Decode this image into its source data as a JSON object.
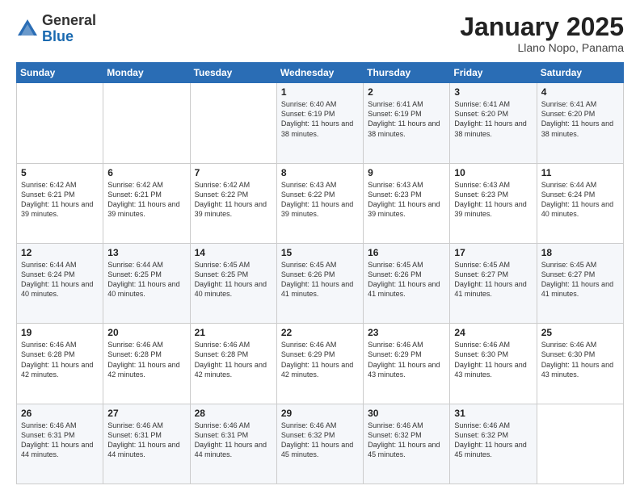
{
  "header": {
    "logo_general": "General",
    "logo_blue": "Blue",
    "month_title": "January 2025",
    "location": "Llano Nopo, Panama"
  },
  "days_of_week": [
    "Sunday",
    "Monday",
    "Tuesday",
    "Wednesday",
    "Thursday",
    "Friday",
    "Saturday"
  ],
  "weeks": [
    [
      {
        "day": "",
        "info": ""
      },
      {
        "day": "",
        "info": ""
      },
      {
        "day": "",
        "info": ""
      },
      {
        "day": "1",
        "info": "Sunrise: 6:40 AM\nSunset: 6:19 PM\nDaylight: 11 hours\nand 38 minutes."
      },
      {
        "day": "2",
        "info": "Sunrise: 6:41 AM\nSunset: 6:19 PM\nDaylight: 11 hours\nand 38 minutes."
      },
      {
        "day": "3",
        "info": "Sunrise: 6:41 AM\nSunset: 6:20 PM\nDaylight: 11 hours\nand 38 minutes."
      },
      {
        "day": "4",
        "info": "Sunrise: 6:41 AM\nSunset: 6:20 PM\nDaylight: 11 hours\nand 38 minutes."
      }
    ],
    [
      {
        "day": "5",
        "info": "Sunrise: 6:42 AM\nSunset: 6:21 PM\nDaylight: 11 hours\nand 39 minutes."
      },
      {
        "day": "6",
        "info": "Sunrise: 6:42 AM\nSunset: 6:21 PM\nDaylight: 11 hours\nand 39 minutes."
      },
      {
        "day": "7",
        "info": "Sunrise: 6:42 AM\nSunset: 6:22 PM\nDaylight: 11 hours\nand 39 minutes."
      },
      {
        "day": "8",
        "info": "Sunrise: 6:43 AM\nSunset: 6:22 PM\nDaylight: 11 hours\nand 39 minutes."
      },
      {
        "day": "9",
        "info": "Sunrise: 6:43 AM\nSunset: 6:23 PM\nDaylight: 11 hours\nand 39 minutes."
      },
      {
        "day": "10",
        "info": "Sunrise: 6:43 AM\nSunset: 6:23 PM\nDaylight: 11 hours\nand 39 minutes."
      },
      {
        "day": "11",
        "info": "Sunrise: 6:44 AM\nSunset: 6:24 PM\nDaylight: 11 hours\nand 40 minutes."
      }
    ],
    [
      {
        "day": "12",
        "info": "Sunrise: 6:44 AM\nSunset: 6:24 PM\nDaylight: 11 hours\nand 40 minutes."
      },
      {
        "day": "13",
        "info": "Sunrise: 6:44 AM\nSunset: 6:25 PM\nDaylight: 11 hours\nand 40 minutes."
      },
      {
        "day": "14",
        "info": "Sunrise: 6:45 AM\nSunset: 6:25 PM\nDaylight: 11 hours\nand 40 minutes."
      },
      {
        "day": "15",
        "info": "Sunrise: 6:45 AM\nSunset: 6:26 PM\nDaylight: 11 hours\nand 41 minutes."
      },
      {
        "day": "16",
        "info": "Sunrise: 6:45 AM\nSunset: 6:26 PM\nDaylight: 11 hours\nand 41 minutes."
      },
      {
        "day": "17",
        "info": "Sunrise: 6:45 AM\nSunset: 6:27 PM\nDaylight: 11 hours\nand 41 minutes."
      },
      {
        "day": "18",
        "info": "Sunrise: 6:45 AM\nSunset: 6:27 PM\nDaylight: 11 hours\nand 41 minutes."
      }
    ],
    [
      {
        "day": "19",
        "info": "Sunrise: 6:46 AM\nSunset: 6:28 PM\nDaylight: 11 hours\nand 42 minutes."
      },
      {
        "day": "20",
        "info": "Sunrise: 6:46 AM\nSunset: 6:28 PM\nDaylight: 11 hours\nand 42 minutes."
      },
      {
        "day": "21",
        "info": "Sunrise: 6:46 AM\nSunset: 6:28 PM\nDaylight: 11 hours\nand 42 minutes."
      },
      {
        "day": "22",
        "info": "Sunrise: 6:46 AM\nSunset: 6:29 PM\nDaylight: 11 hours\nand 42 minutes."
      },
      {
        "day": "23",
        "info": "Sunrise: 6:46 AM\nSunset: 6:29 PM\nDaylight: 11 hours\nand 43 minutes."
      },
      {
        "day": "24",
        "info": "Sunrise: 6:46 AM\nSunset: 6:30 PM\nDaylight: 11 hours\nand 43 minutes."
      },
      {
        "day": "25",
        "info": "Sunrise: 6:46 AM\nSunset: 6:30 PM\nDaylight: 11 hours\nand 43 minutes."
      }
    ],
    [
      {
        "day": "26",
        "info": "Sunrise: 6:46 AM\nSunset: 6:31 PM\nDaylight: 11 hours\nand 44 minutes."
      },
      {
        "day": "27",
        "info": "Sunrise: 6:46 AM\nSunset: 6:31 PM\nDaylight: 11 hours\nand 44 minutes."
      },
      {
        "day": "28",
        "info": "Sunrise: 6:46 AM\nSunset: 6:31 PM\nDaylight: 11 hours\nand 44 minutes."
      },
      {
        "day": "29",
        "info": "Sunrise: 6:46 AM\nSunset: 6:32 PM\nDaylight: 11 hours\nand 45 minutes."
      },
      {
        "day": "30",
        "info": "Sunrise: 6:46 AM\nSunset: 6:32 PM\nDaylight: 11 hours\nand 45 minutes."
      },
      {
        "day": "31",
        "info": "Sunrise: 6:46 AM\nSunset: 6:32 PM\nDaylight: 11 hours\nand 45 minutes."
      },
      {
        "day": "",
        "info": ""
      }
    ]
  ]
}
